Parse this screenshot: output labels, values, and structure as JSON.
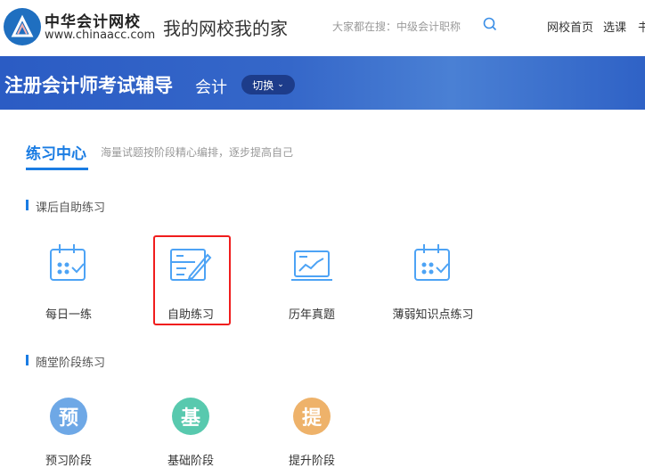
{
  "header": {
    "logo_name": "中华会计网校",
    "logo_url": "www.chinaacc.com",
    "slogan": "我的网校我的家",
    "search_hint": "大家都在搜：中级会计职称",
    "nav": [
      "网校首页",
      "选课",
      "书"
    ]
  },
  "banner": {
    "title": "注册会计师考试辅导",
    "subject": "会计",
    "switch_label": "切换"
  },
  "main": {
    "tab_title": "练习中心",
    "tab_desc": "海量试题按阶段精心编排，逐步提高自己",
    "section1": {
      "title": "课后自助练习",
      "items": [
        {
          "label": "每日一练",
          "icon": "calendar-check-icon"
        },
        {
          "label": "自助练习",
          "icon": "notepad-pen-icon"
        },
        {
          "label": "历年真题",
          "icon": "laptop-chart-icon"
        },
        {
          "label": "薄弱知识点练习",
          "icon": "calendar-check-icon"
        }
      ]
    },
    "section2": {
      "title": "随堂阶段练习",
      "items": [
        {
          "label": "预习阶段",
          "glyph": "预",
          "color": "#6ea8e6"
        },
        {
          "label": "基础阶段",
          "glyph": "基",
          "color": "#58c9ae"
        },
        {
          "label": "提升阶段",
          "glyph": "提",
          "color": "#eeb26a"
        }
      ]
    }
  },
  "colors": {
    "accent": "#1a7ce3",
    "highlight": "#f01d1d",
    "icon": "#4da3f5"
  }
}
